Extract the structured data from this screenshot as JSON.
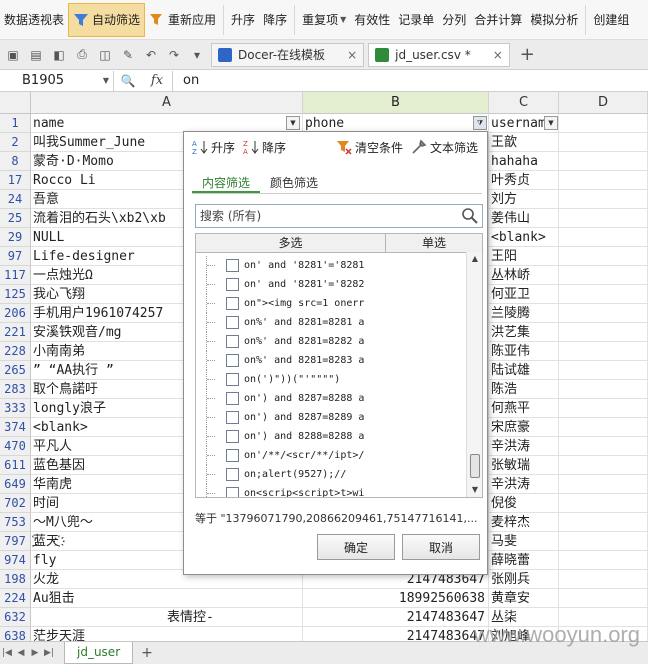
{
  "ribbon": {
    "items": [
      {
        "name": "pivot",
        "label": "数据透视表"
      },
      {
        "name": "autofilter",
        "label": "自动筛选",
        "active": true
      },
      {
        "name": "reapply",
        "label": "重新应用"
      },
      {
        "name": "sort-asc",
        "label": "升序"
      },
      {
        "name": "sort-desc",
        "label": "降序"
      },
      {
        "name": "duplicates",
        "label": "重复项"
      },
      {
        "name": "validity",
        "label": "有效性"
      },
      {
        "name": "record",
        "label": "记录单"
      },
      {
        "name": "split",
        "label": "分列"
      },
      {
        "name": "consolidate",
        "label": "合并计算"
      },
      {
        "name": "whatif",
        "label": "模拟分析"
      },
      {
        "name": "group",
        "label": "创建组"
      }
    ]
  },
  "tabs": [
    {
      "label": "Docer-在线模板",
      "close": "×"
    },
    {
      "label": "jd_user.csv *",
      "close": "×"
    }
  ],
  "new_tab": "+",
  "formula": {
    "cell_ref": "B1905",
    "fx": "fx",
    "value": "on"
  },
  "columns": [
    {
      "letter": "A",
      "header": "name"
    },
    {
      "letter": "B",
      "header": "phone"
    },
    {
      "letter": "C",
      "header": "username"
    },
    {
      "letter": "D",
      "header": ""
    }
  ],
  "rows": [
    {
      "n": "1",
      "a": "name",
      "b": "phone",
      "c": "usernam"
    },
    {
      "n": "2",
      "a": "叫我Summer_June",
      "b": "",
      "c": "王歆"
    },
    {
      "n": "8",
      "a": "蒙奇·D·Momo",
      "b": "",
      "c": "hahaha"
    },
    {
      "n": "17",
      "a": "Rocco Li",
      "b": "",
      "c": "叶秀贞"
    },
    {
      "n": "24",
      "a": "吾意",
      "b": "",
      "c": "刘方"
    },
    {
      "n": "25",
      "a": "流着泪的石头\\xb2\\xb",
      "b": "",
      "c": "姜伟山"
    },
    {
      "n": "29",
      "a": "NULL",
      "b": "",
      "c": "<blank>"
    },
    {
      "n": "97",
      "a": "Life-designer",
      "b": "",
      "c": "王阳"
    },
    {
      "n": "117",
      "a": "一点烛光Ω",
      "b": "",
      "c": "丛林峤"
    },
    {
      "n": "125",
      "a": "我心飞翔",
      "b": "",
      "c": "何亚卫"
    },
    {
      "n": "206",
      "a": "手机用户1961074257",
      "b": "",
      "c": "兰陵腾"
    },
    {
      "n": "221",
      "a": "安溪铁观音/mg",
      "b": "",
      "c": "洪艺集"
    },
    {
      "n": "228",
      "a": "小南南弟",
      "b": "",
      "c": "陈亚伟"
    },
    {
      "n": "265",
      "a": " ” “AA执行 ”",
      "b": "",
      "c": "陆试雄"
    },
    {
      "n": "283",
      "a": " 取个鳥諾吁",
      "b": "",
      "c": "陈浩"
    },
    {
      "n": "333",
      "a": "longly浪子",
      "b": "",
      "c": "何燕平"
    },
    {
      "n": "374",
      "a": "<blank>",
      "b": "",
      "c": "宋庶豪"
    },
    {
      "n": "470",
      "a": "平凡人",
      "b": "",
      "c": "辛洪涛"
    },
    {
      "n": "611",
      "a": "蓝色基因",
      "b": "",
      "c": "张敏瑞"
    },
    {
      "n": "649",
      "b": "",
      "a": "华南虎",
      "c": "辛洪涛"
    },
    {
      "n": "702",
      "a": "时间",
      "b": "",
      "c": "倪俊"
    },
    {
      "n": "753",
      "a": "～M八兜～",
      "b": "",
      "c": "麦梓杰"
    },
    {
      "n": "797",
      "a": "҉蓝天҉",
      "b": "",
      "c": "马斐"
    },
    {
      "n": "974",
      "a": "fly",
      "b": "",
      "c": "薛晓蕾"
    },
    {
      "n": "198",
      "a": "火龙",
      "b": "2147483647",
      "c": "张刚兵"
    },
    {
      "n": "224",
      "a": "Au狙击",
      "b": "18992560638",
      "c": "黄章安"
    },
    {
      "n": "632",
      "a": "表情控-",
      "b": "2147483647",
      "c": "丛柒"
    },
    {
      "n": "638",
      "a": "茫步天涯",
      "b": "2147483647",
      "c": "刘旭峰"
    }
  ],
  "filter_popup": {
    "sort_asc": "升序",
    "sort_desc": "降序",
    "clear": "清空条件",
    "text_filter": "文本筛选",
    "tab_content": "内容筛选",
    "tab_color": "颜色筛选",
    "search_placeholder": "搜索 (所有)",
    "head_multi": "多选",
    "head_single": "单选",
    "items": [
      "on' and '8281'='8281",
      "on' and '8281'='8282",
      "on\"><img src=1 onerr",
      "on%' and 8281=8281 a",
      "on%' and 8281=8282 a",
      "on%' and 8281=8283 a",
      "on(')\"))(\"'\"\"\"\")",
      "on') and 8287=8288 a",
      "on') and 8287=8289 a",
      "on') and 8288=8288 a",
      "on'/**/<scr/**/ipt>/",
      "on;alert(9527);//",
      "on<scrip<script>t>wi"
    ],
    "status": "等于 \"13796071790,20866209461,75147716141,...",
    "ok": "确定",
    "cancel": "取消"
  },
  "sheet": {
    "name": "jd_user",
    "add": "+"
  },
  "watermark": "www.wooyun.org"
}
